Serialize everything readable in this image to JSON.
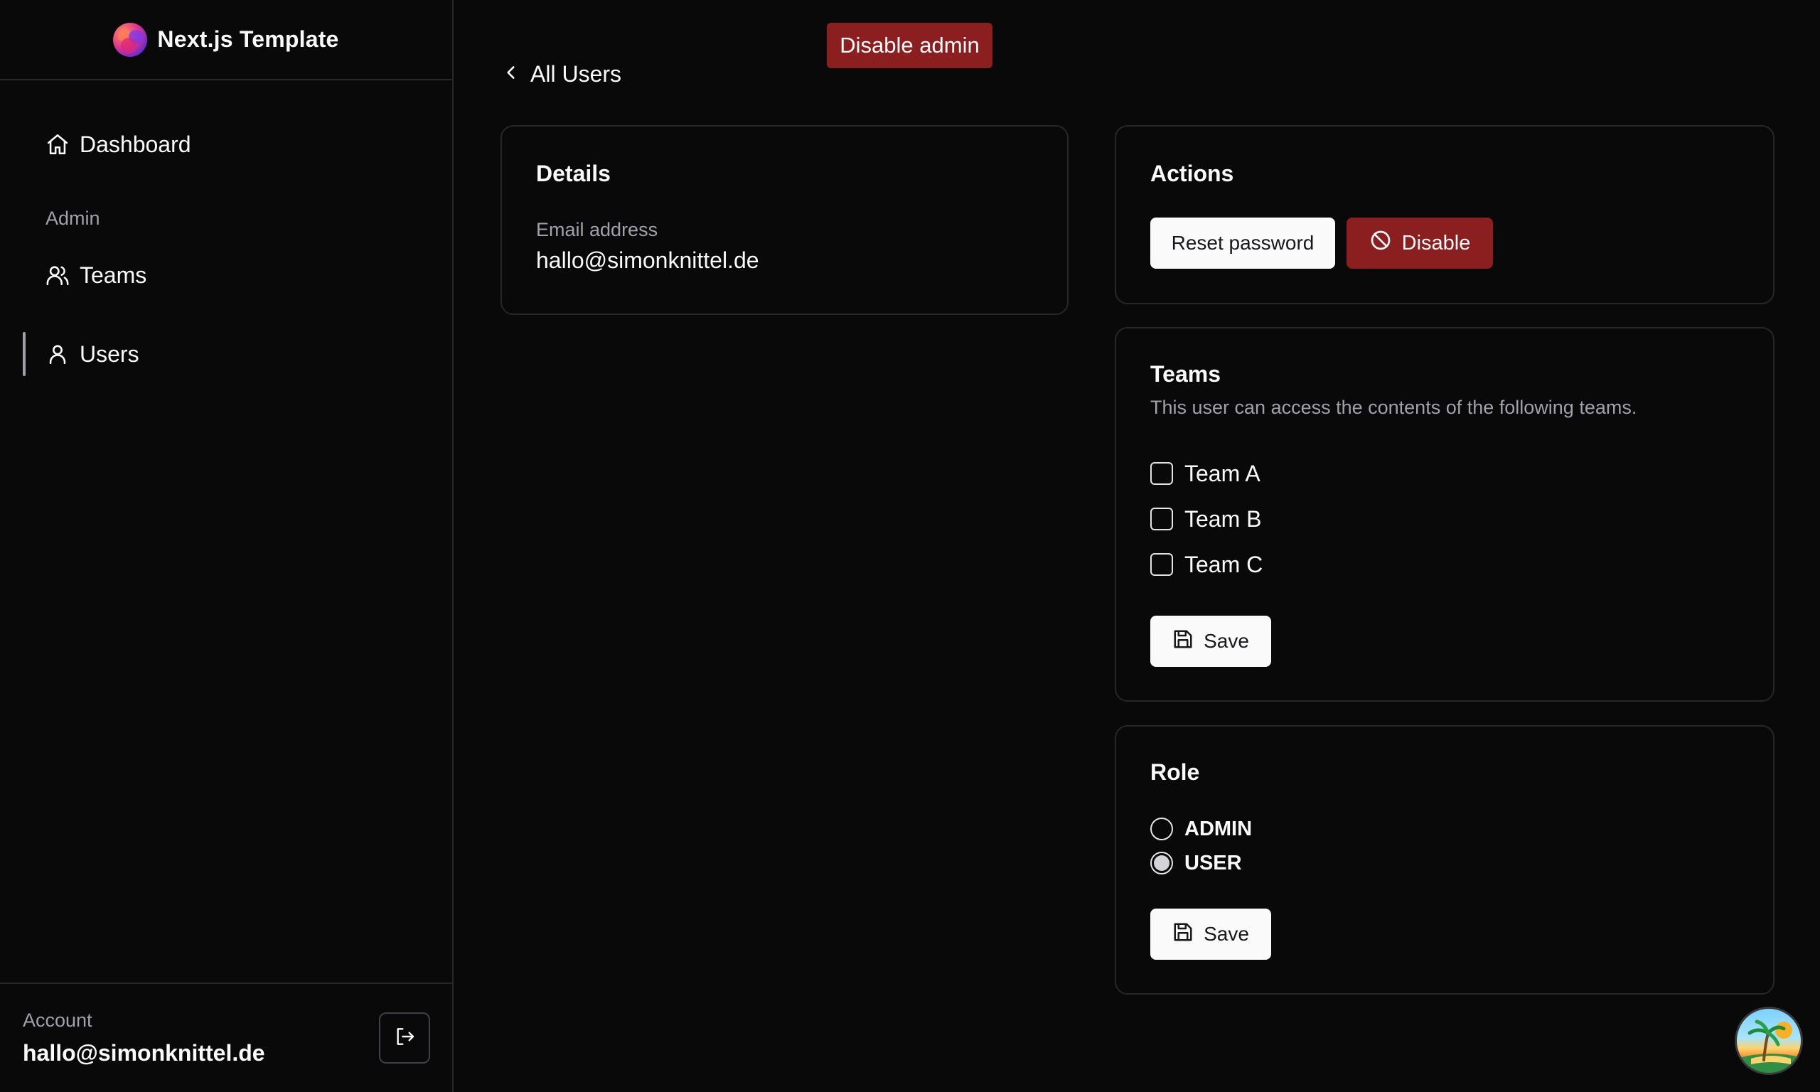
{
  "brand": {
    "title": "Next.js Template"
  },
  "sidebar": {
    "items": [
      {
        "label": "Dashboard",
        "icon": "home-icon"
      },
      {
        "label": "Teams",
        "icon": "users-icon"
      },
      {
        "label": "Users",
        "icon": "user-icon",
        "active": true
      }
    ],
    "section_label": "Admin"
  },
  "account": {
    "label": "Account",
    "email": "hallo@simonknittel.de"
  },
  "topbar": {
    "disable_admin_label": "Disable admin"
  },
  "breadcrumb": {
    "back_label": "All Users"
  },
  "details": {
    "title": "Details",
    "email_label": "Email address",
    "email_value": "hallo@simonknittel.de"
  },
  "actions": {
    "title": "Actions",
    "reset_password_label": "Reset password",
    "disable_label": "Disable"
  },
  "teams": {
    "title": "Teams",
    "description": "This user can access the contents of the following teams.",
    "options": [
      {
        "label": "Team A",
        "checked": false
      },
      {
        "label": "Team B",
        "checked": false
      },
      {
        "label": "Team C",
        "checked": false
      }
    ],
    "save_label": "Save"
  },
  "role": {
    "title": "Role",
    "options": [
      {
        "label": "ADMIN",
        "selected": false
      },
      {
        "label": "USER",
        "selected": true
      }
    ],
    "save_label": "Save"
  },
  "colors": {
    "background": "#09090a",
    "border": "#27272a",
    "danger": "#8b1e1e",
    "muted_text": "#a1a1aa",
    "text": "#fafafa"
  }
}
